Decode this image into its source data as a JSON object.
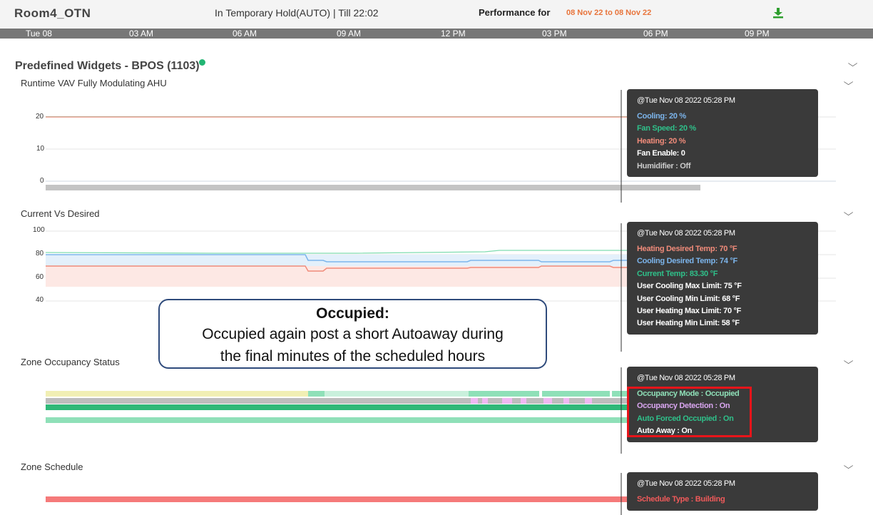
{
  "header": {
    "room_name": "Room4_OTN",
    "hold_status": "In Temporary Hold(AUTO) | Till 22:02",
    "performance_label": "Performance for",
    "performance_range": "08 Nov 22 to 08 Nov 22",
    "download_icon": "download-icon"
  },
  "timeline": {
    "ticks": [
      "Tue 08",
      "03 AM",
      "06 AM",
      "09 AM",
      "12 PM",
      "03 PM",
      "06 PM",
      "09 PM"
    ]
  },
  "widgets": {
    "title": "Predefined Widgets - BPOS (1103)"
  },
  "colors": {
    "cooling": "#7cb5ec",
    "fan_speed": "#2fc08a",
    "heating": "#f08b7a",
    "occupied_red": "#e8141a"
  },
  "sections": {
    "runtime": {
      "title": "Runtime VAV Fully Modulating AHU",
      "chart_data": {
        "type": "line",
        "y_ticks": [
          "20",
          "10",
          "0"
        ],
        "ylim": [
          0,
          20
        ],
        "series": [
          {
            "name": "Heating",
            "values": [
              20,
              20
            ]
          },
          {
            "name": "Fan Speed",
            "values": [
              20,
              20
            ]
          },
          {
            "name": "Cooling",
            "values": [
              20,
              20
            ]
          }
        ]
      },
      "tooltip": {
        "timestamp": "@Tue Nov 08 2022 05:28 PM",
        "lines": [
          {
            "text": "Cooling: 20 %",
            "color": "#7cb5ec"
          },
          {
            "text": "Fan Speed: 20 %",
            "color": "#2fc08a"
          },
          {
            "text": "Heating: 20 %",
            "color": "#f08b7a"
          },
          {
            "text": "Fan Enable: 0",
            "color": "#ffffff"
          },
          {
            "text": "Humidifier : Off",
            "color": "#cccccc"
          }
        ]
      }
    },
    "current_vs_desired": {
      "title": "Current Vs Desired",
      "chart_data": {
        "type": "line",
        "y_ticks": [
          "100",
          "80",
          "60",
          "40"
        ],
        "ylim": [
          40,
          100
        ]
      },
      "tooltip": {
        "timestamp": "@Tue Nov 08 2022 05:28 PM",
        "lines": [
          {
            "text": "Heating Desired Temp: 70 °F",
            "color": "#f08b7a"
          },
          {
            "text": "Cooling Desired Temp: 74 °F",
            "color": "#7cb5ec"
          },
          {
            "text": "Current Temp: 83.30 °F",
            "color": "#2fc08a"
          },
          {
            "text": "User Cooling Max Limit: 75 °F",
            "color": "#ffffff"
          },
          {
            "text": "User Cooling Min Limit: 68 °F",
            "color": "#ffffff"
          },
          {
            "text": "User Heating Max Limit: 70 °F",
            "color": "#ffffff"
          },
          {
            "text": "User Heating Min Limit: 58 °F",
            "color": "#ffffff"
          }
        ]
      }
    },
    "zone_occupancy": {
      "title": "Zone Occupancy Status",
      "tooltip": {
        "timestamp": "@Tue Nov 08 2022 05:28 PM",
        "lines": [
          {
            "text": "Occupancy Mode : Occupied",
            "color": "#8fe0b8"
          },
          {
            "text": "Occupancy Detection : On",
            "color": "#d9a6f0"
          },
          {
            "text": "Auto Forced Occupied : On",
            "color": "#2fc08a"
          },
          {
            "text": "Auto Away : On",
            "color": "#ffffff"
          }
        ]
      }
    },
    "zone_schedule": {
      "title": "Zone Schedule",
      "tooltip": {
        "timestamp": "@Tue Nov 08 2022 05:28 PM",
        "lines": [
          {
            "text": "Schedule Type : Building",
            "color": "#f05a5a"
          }
        ]
      }
    }
  },
  "callout": {
    "title": "Occupied:",
    "body_line1": "Occupied again post a short Autoaway during",
    "body_line2": "the final minutes of the scheduled hours"
  }
}
